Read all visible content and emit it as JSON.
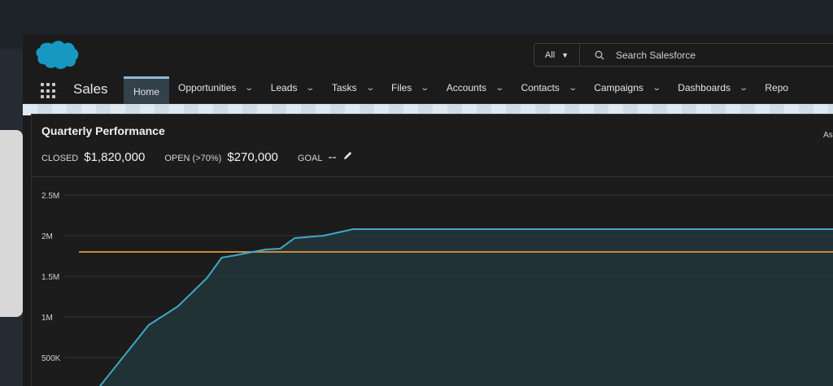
{
  "search": {
    "scope_label": "All",
    "placeholder": "Search Salesforce"
  },
  "nav": {
    "app_name": "Sales",
    "tabs": [
      {
        "label": "Home",
        "active": true,
        "dropdown": false
      },
      {
        "label": "Opportunities",
        "dropdown": true
      },
      {
        "label": "Leads",
        "dropdown": true
      },
      {
        "label": "Tasks",
        "dropdown": true
      },
      {
        "label": "Files",
        "dropdown": true
      },
      {
        "label": "Accounts",
        "dropdown": true
      },
      {
        "label": "Contacts",
        "dropdown": true
      },
      {
        "label": "Campaigns",
        "dropdown": true
      },
      {
        "label": "Dashboards",
        "dropdown": true
      },
      {
        "label": "Repo",
        "dropdown": false
      }
    ]
  },
  "card": {
    "title": "Quarterly Performance",
    "corner_text": "As",
    "closed_label": "CLOSED",
    "closed_value": "$1,820,000",
    "open_label": "OPEN (>70%)",
    "open_value": "$270,000",
    "goal_label": "GOAL",
    "goal_value": "--"
  },
  "colors": {
    "brand": "#1798c1",
    "line": "#3fa9c6",
    "goal_line": "#c78a3a",
    "area_fill": "#22353a"
  },
  "chart_data": {
    "type": "area",
    "ylabel": "",
    "xlabel": "",
    "y_ticks": [
      "2.5M",
      "2M",
      "1.5M",
      "1M",
      "500K"
    ],
    "y_tick_values": [
      2500000,
      2000000,
      1500000,
      1000000,
      500000
    ],
    "ylim": [
      0,
      2500000
    ],
    "x": [
      0,
      4,
      6,
      8,
      9,
      10,
      12,
      13,
      14,
      16,
      18,
      100
    ],
    "series": [
      {
        "values": [
          0,
          900000,
          1130000,
          1480000,
          1730000,
          1760000,
          1830000,
          1840000,
          1970000,
          2000000,
          2080000,
          2080000
        ]
      }
    ],
    "goal_value": 1800000,
    "grid": true
  }
}
